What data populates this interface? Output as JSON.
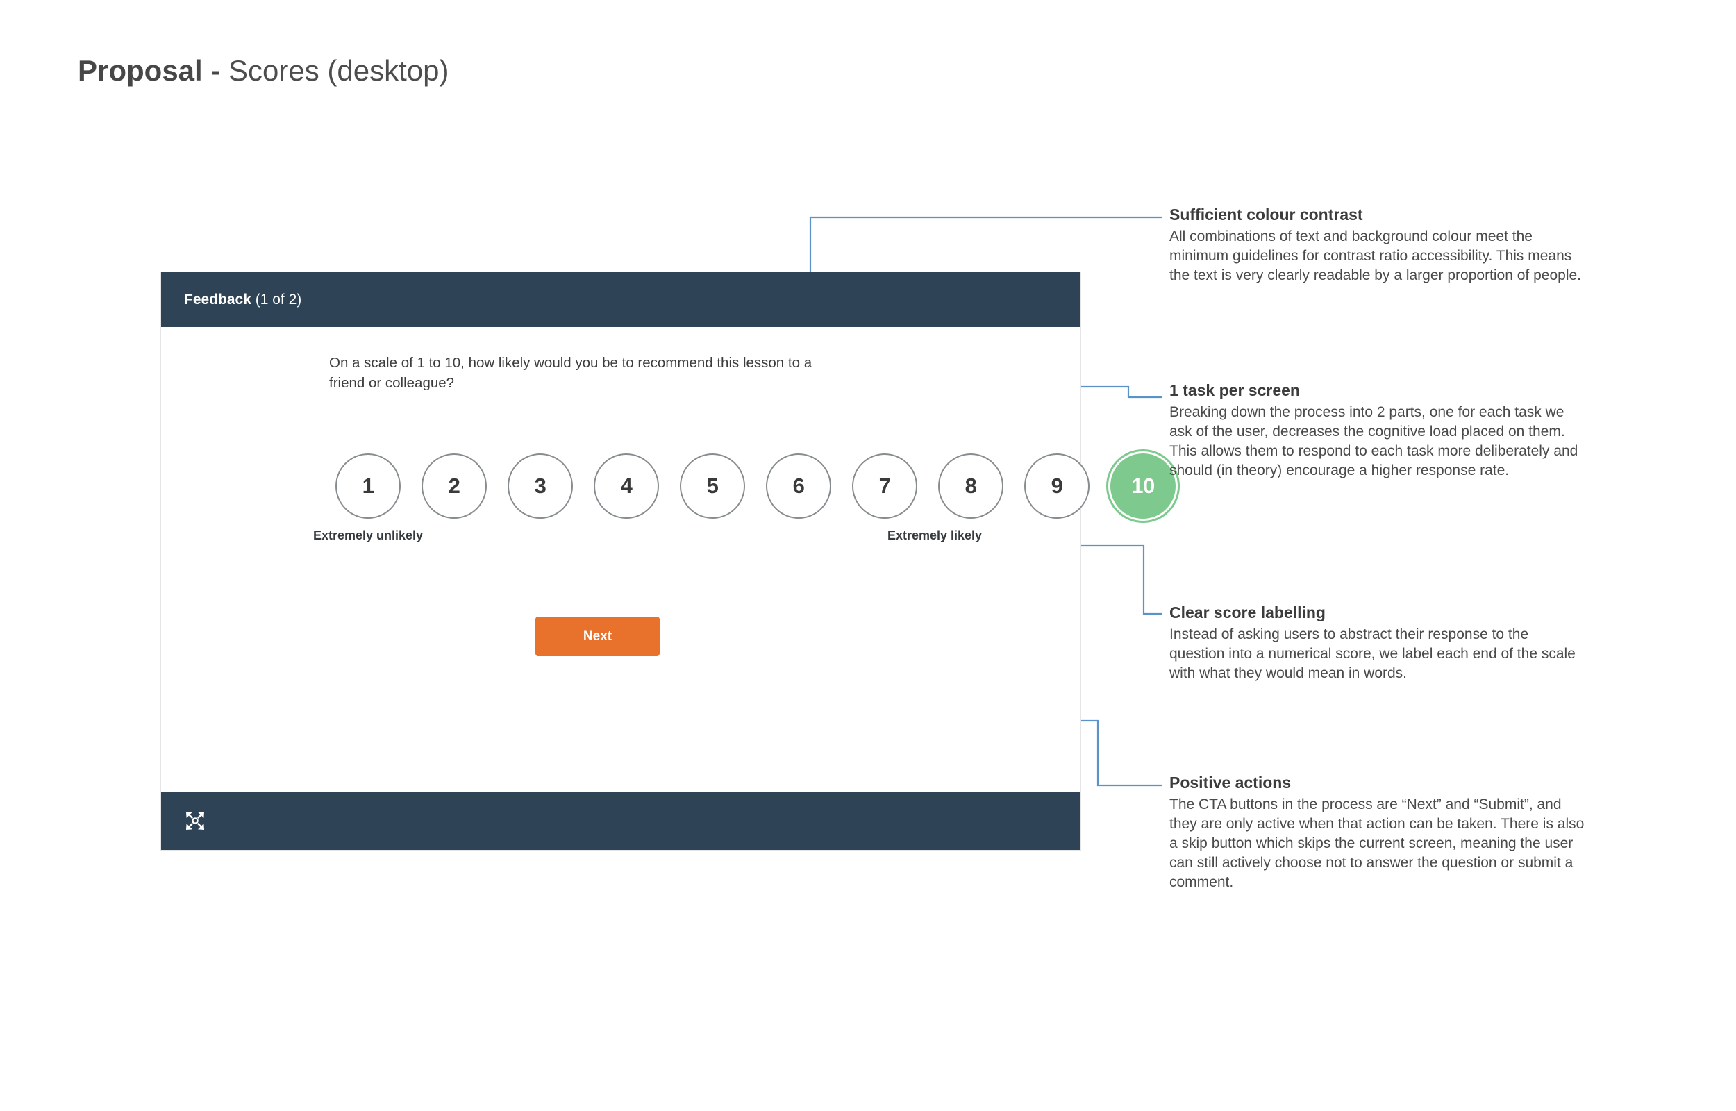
{
  "slide": {
    "title_strong": "Proposal -",
    "title_rest": " Scores (desktop)"
  },
  "mockup": {
    "header": {
      "title_strong": "Feedback",
      "title_rest": " (1 of 2)"
    },
    "question": "On a scale of 1 to 10, how likely would you be to recommend this lesson to a friend or colleague?",
    "scale": {
      "options": [
        "1",
        "2",
        "3",
        "4",
        "5",
        "6",
        "7",
        "8",
        "9",
        "10"
      ],
      "selected_value": "10",
      "low_label": "Extremely unlikely",
      "high_label": "Extremely likely"
    },
    "cta": {
      "next_label": "Next"
    },
    "footer": {
      "expand_icon": "fullscreen-expand-icon"
    }
  },
  "annotations": [
    {
      "title": "Sufficient colour contrast",
      "body": "All combinations of text and background colour meet the minimum guidelines for contrast ratio accessibility. This means the text is very clearly readable by a larger proportion of people."
    },
    {
      "title": "1 task per screen",
      "body": "Breaking down the process into 2 parts, one for each task we ask of the user, decreases the cognitive load placed on them. This allows them to respond to each task more deliberately and should (in theory) encourage a higher response rate."
    },
    {
      "title": "Clear score labelling",
      "body": "Instead of asking users to abstract their response to the question into a numerical score, we label each end of the scale with what they would mean in words."
    },
    {
      "title": "Positive actions",
      "body": "The CTA buttons in the process are “Next” and “Submit”, and they are only active when that action can be taken. There is also a skip button which skips the current screen, meaning the user can still actively choose not to answer the question or submit a comment."
    }
  ],
  "colors": {
    "panel_dark": "#2E4456",
    "cta_orange": "#E8722C",
    "selected_green": "#7EC98D",
    "leader_line_blue": "#5B92C8",
    "page_background": "#FFFFFF"
  }
}
